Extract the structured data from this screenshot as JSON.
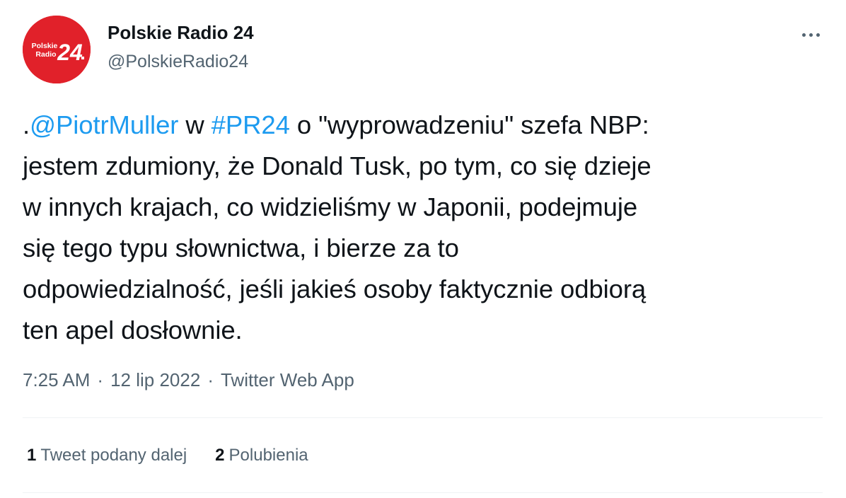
{
  "account": {
    "name": "Polskie Radio 24",
    "handle": "@PolskieRadio24",
    "avatar_text_line1": "Polskie",
    "avatar_text_line2": "Radio",
    "avatar_number": "24",
    "avatar_color": "#e1212a"
  },
  "menu": {
    "icon": "more-horizontal-icon"
  },
  "tweet": {
    "line1": {
      "prefix": ".",
      "mention": "@PiotrMuller",
      "mid": " w ",
      "hashtag": "#PR24",
      "rest": " o \"wyprowadzeniu\" szefa NBP:"
    },
    "line2": "jestem zdumiony, że Donald Tusk, po tym, co się dzieje",
    "line3": "w innych krajach, co widzieliśmy w Japonii, podejmuje",
    "line4": "się tego typu słownictwa, i bierze za to",
    "line5": "odpowiedzialność, jeśli jakieś osoby faktycznie odbiorą",
    "line6": "ten apel dosłownie."
  },
  "meta": {
    "time": "7:25 AM",
    "separator": "·",
    "date": "12 lip 2022",
    "source": "Twitter Web App"
  },
  "stats": {
    "retweets_count": "1",
    "retweets_label": "Tweet podany dalej",
    "likes_count": "2",
    "likes_label": "Polubienia"
  },
  "colors": {
    "link": "#1d9bf0",
    "secondary_text": "#536471",
    "primary_text": "#0f1419",
    "divider": "#eff3f4"
  }
}
